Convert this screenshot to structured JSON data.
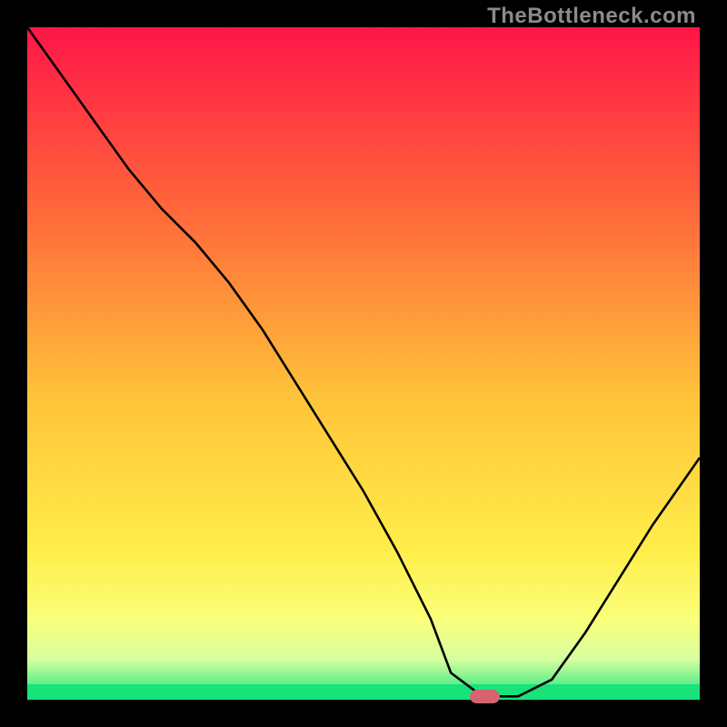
{
  "watermark": "TheBottleneck.com",
  "chart_data": {
    "type": "line",
    "title": "",
    "xlabel": "",
    "ylabel": "",
    "xlim": [
      0,
      100
    ],
    "ylim": [
      0,
      100
    ],
    "x": [
      0,
      5,
      10,
      15,
      20,
      25,
      30,
      35,
      40,
      45,
      50,
      55,
      60,
      63,
      67,
      70,
      73,
      78,
      83,
      88,
      93,
      100
    ],
    "values": [
      100,
      93,
      86,
      79,
      73,
      68,
      62,
      55,
      47,
      39,
      31,
      22,
      12,
      4,
      1,
      0.5,
      0.5,
      3,
      10,
      18,
      26,
      36
    ],
    "gradient_stops": [
      {
        "pos": 0,
        "color": "#ff1547"
      },
      {
        "pos": 28,
        "color": "#ff6a3a"
      },
      {
        "pos": 55,
        "color": "#ffc339"
      },
      {
        "pos": 78,
        "color": "#ffee4a"
      },
      {
        "pos": 88,
        "color": "#faff7a"
      },
      {
        "pos": 94,
        "color": "#d6ffa0"
      },
      {
        "pos": 100,
        "color": "#17e37a"
      }
    ],
    "green_strip_height_pct": 2.3,
    "green_strip_color": "#17e37a",
    "marker": {
      "x": 68,
      "y": 0.5,
      "w_pct": 4.5,
      "h_pct": 2.1,
      "color": "#d6636f"
    },
    "annotations": []
  }
}
